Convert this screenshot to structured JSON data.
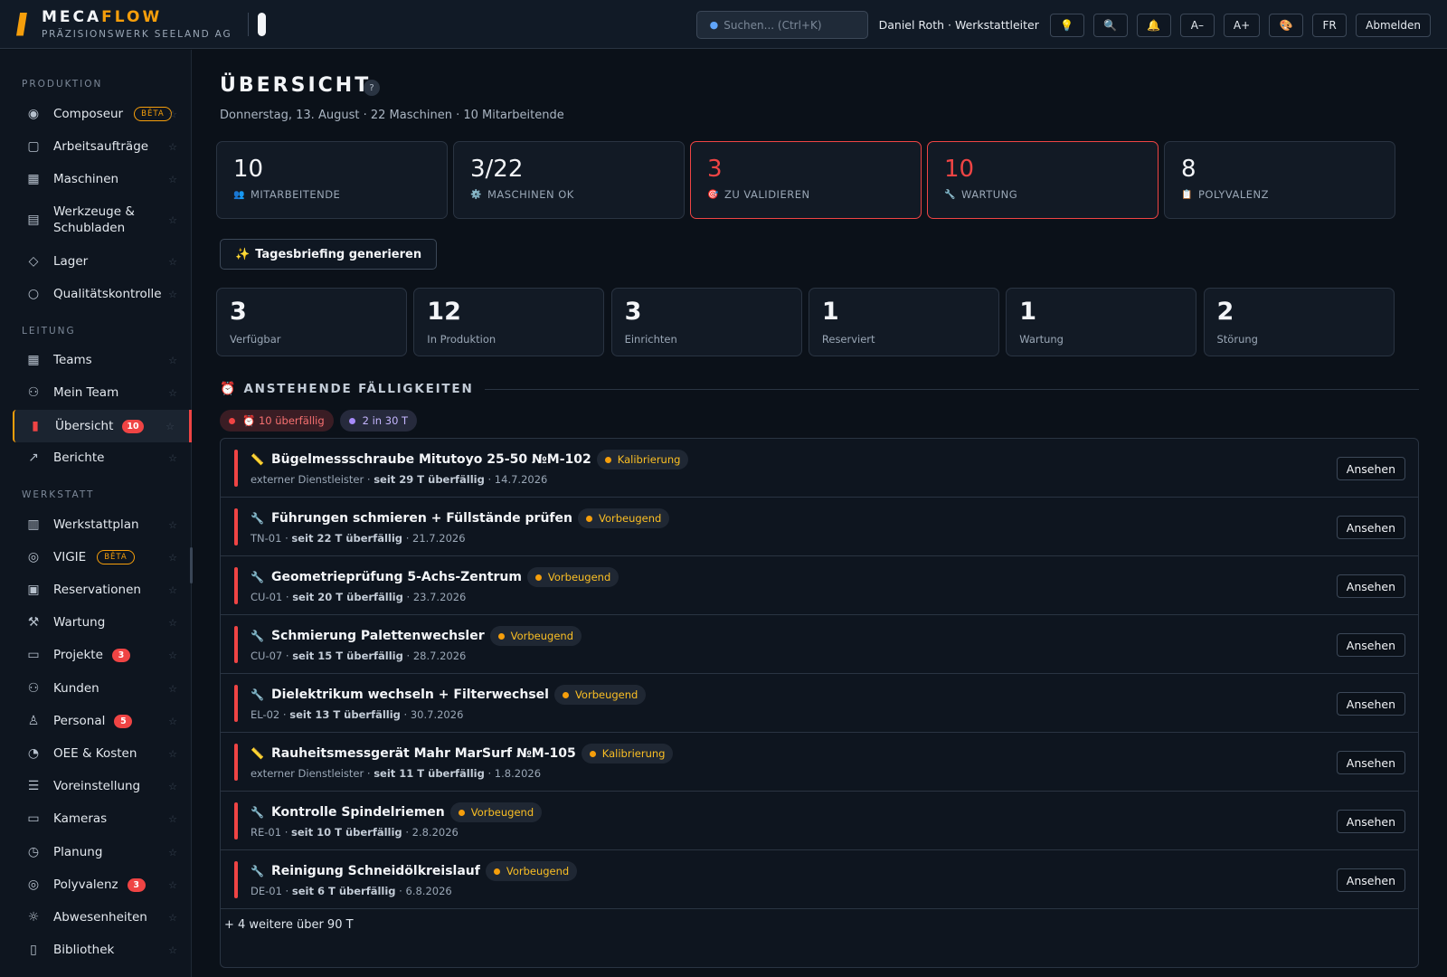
{
  "brand": {
    "name_main": "MECA",
    "name_accent": "FLOW",
    "subtitle": "PRÄZISIONSWERK SEELAND AG",
    "accent_color": "#f59e0b"
  },
  "topbar": {
    "search_placeholder": "Suchen...  (Ctrl+K)",
    "user": "Daniel Roth · Werkstattleiter",
    "buttons": {
      "tips": "💡",
      "search": "🔍",
      "notifications": "🔔",
      "font_smaller": "A–",
      "font_larger": "A+",
      "theme": "🎨",
      "language": "FR",
      "logout": "Abmelden"
    }
  },
  "sidebar": {
    "sections": {
      "produktion": "PRODUKTION",
      "leitung": "LEITUNG",
      "werkstatt": "WERKSTATT"
    },
    "star": "☆",
    "beta": "BÊTA",
    "items": [
      {
        "label": "Composeur",
        "icon": "composer-icon",
        "glyph": "◉",
        "badge": "beta"
      },
      {
        "label": "Arbeitsaufträge",
        "icon": "clipboard-icon",
        "glyph": "▢"
      },
      {
        "label": "Maschinen",
        "icon": "grid-icon",
        "glyph": "▦"
      },
      {
        "label": "Werkzeuge & Schubladen",
        "icon": "archive-icon",
        "glyph": "▤"
      },
      {
        "label": "Lager",
        "icon": "box-icon",
        "glyph": "◇"
      },
      {
        "label": "Qualitätskontrolle",
        "icon": "search-icon",
        "glyph": "○"
      },
      {
        "label": "Teams",
        "icon": "grid-icon",
        "glyph": "▦"
      },
      {
        "label": "Mein Team",
        "icon": "users-icon",
        "glyph": "⚇"
      },
      {
        "label": "Übersicht",
        "icon": "bar-chart-icon",
        "glyph": "▮",
        "badge": "10",
        "active": true
      },
      {
        "label": "Berichte",
        "icon": "trend-icon",
        "glyph": "↗"
      },
      {
        "label": "Werkstattplan",
        "icon": "map-icon",
        "glyph": "▥"
      },
      {
        "label": "VIGIE",
        "icon": "target-icon",
        "glyph": "◎",
        "badge": "beta"
      },
      {
        "label": "Reservationen",
        "icon": "calendar-icon",
        "glyph": "▣"
      },
      {
        "label": "Wartung",
        "icon": "wrench-icon",
        "glyph": "⚒"
      },
      {
        "label": "Projekte",
        "icon": "folder-icon",
        "glyph": "▭",
        "badge": "3"
      },
      {
        "label": "Kunden",
        "icon": "users-icon",
        "glyph": "⚇"
      },
      {
        "label": "Personal",
        "icon": "user-icon",
        "glyph": "♙",
        "badge": "5"
      },
      {
        "label": "OEE & Kosten",
        "icon": "gauge-icon",
        "glyph": "◔"
      },
      {
        "label": "Voreinstellung",
        "icon": "sliders-icon",
        "glyph": "☰"
      },
      {
        "label": "Kameras",
        "icon": "monitor-icon",
        "glyph": "▭"
      },
      {
        "label": "Planung",
        "icon": "clock-icon",
        "glyph": "◷"
      },
      {
        "label": "Polyvalenz",
        "icon": "target-icon",
        "glyph": "◎",
        "badge": "3"
      },
      {
        "label": "Abwesenheiten",
        "icon": "sun-icon",
        "glyph": "☼"
      },
      {
        "label": "Bibliothek",
        "icon": "book-icon",
        "glyph": "▯"
      }
    ]
  },
  "main": {
    "title": "ÜBERSICHT",
    "help": "?",
    "subtitle": "Donnerstag, 13. August · 22 Maschinen · 10 Mitarbeitende",
    "kpis": [
      {
        "value": "10",
        "label": "MITARBEITENDE",
        "icon": "👥",
        "alert": false
      },
      {
        "value": "3/22",
        "label": "MASCHINEN OK",
        "icon": "⚙️",
        "alert": false
      },
      {
        "value": "3",
        "label": "ZU VALIDIEREN",
        "icon": "🎯",
        "alert": true
      },
      {
        "value": "10",
        "label": "WARTUNG",
        "icon": "🔧",
        "alert": true
      },
      {
        "value": "8",
        "label": "POLYVALENZ",
        "icon": "📋",
        "alert": false
      }
    ],
    "briefing": {
      "icon": "✨",
      "label": "Tagesbriefing generieren"
    },
    "machine_status": [
      {
        "value": "3",
        "label": "Verfügbar"
      },
      {
        "value": "12",
        "label": "In Produktion"
      },
      {
        "value": "3",
        "label": "Einrichten"
      },
      {
        "value": "1",
        "label": "Reserviert"
      },
      {
        "value": "1",
        "label": "Wartung"
      },
      {
        "value": "2",
        "label": "Störung"
      }
    ],
    "due": {
      "icon": "⏰",
      "title": "ANSTEHENDE FÄLLIGKEITEN",
      "filters": {
        "overdue": "⏰ 10 überfällig",
        "upcoming": "2 in 30 T"
      },
      "view_label": "Ansehen",
      "rows": [
        {
          "icon": "📏",
          "name": "Bügelmessschraube Mitutoyo 25-50 №M-102",
          "tag": "Kalibrierung",
          "source": "externer Dienstleister · ",
          "overdue": "seit 29 T überfällig",
          "date": " · 14.7.2026"
        },
        {
          "icon": "🔧",
          "name": "Führungen schmieren + Füllstände prüfen",
          "tag": "Vorbeugend",
          "source": "TN-01 · ",
          "overdue": "seit 22 T überfällig",
          "date": " · 21.7.2026"
        },
        {
          "icon": "🔧",
          "name": "Geometrieprüfung 5-Achs-Zentrum",
          "tag": "Vorbeugend",
          "source": "CU-01 · ",
          "overdue": "seit 20 T überfällig",
          "date": " · 23.7.2026"
        },
        {
          "icon": "🔧",
          "name": "Schmierung Palettenwechsler",
          "tag": "Vorbeugend",
          "source": "CU-07 · ",
          "overdue": "seit 15 T überfällig",
          "date": " · 28.7.2026"
        },
        {
          "icon": "🔧",
          "name": "Dielektrikum wechseln + Filterwechsel",
          "tag": "Vorbeugend",
          "source": "EL-02 · ",
          "overdue": "seit 13 T überfällig",
          "date": " · 30.7.2026"
        },
        {
          "icon": "📏",
          "name": "Rauheitsmessgerät Mahr MarSurf №M-105",
          "tag": "Kalibrierung",
          "source": "externer Dienstleister · ",
          "overdue": "seit 11 T überfällig",
          "date": " · 1.8.2026"
        },
        {
          "icon": "🔧",
          "name": "Kontrolle Spindelriemen",
          "tag": "Vorbeugend",
          "source": "RE-01 · ",
          "overdue": "seit 10 T überfällig",
          "date": " · 2.8.2026"
        },
        {
          "icon": "🔧",
          "name": "Reinigung Schneidölkreislauf",
          "tag": "Vorbeugend",
          "source": "DE-01 · ",
          "overdue": "seit 6 T überfällig",
          "date": " · 6.8.2026"
        }
      ],
      "more": "+ 4 weitere über 90 T"
    }
  }
}
